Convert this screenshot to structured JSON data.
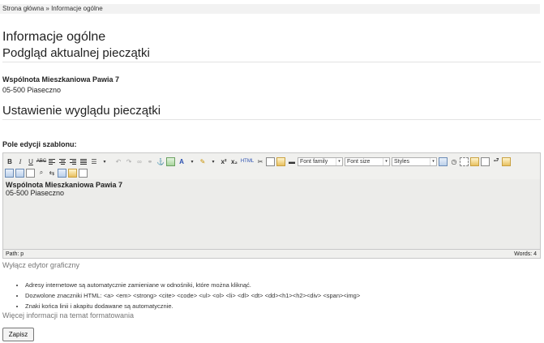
{
  "breadcrumb": {
    "home": "Strona główna",
    "separator": " » ",
    "current": "Informacje ogólne"
  },
  "page_title": "Informacje ogólne",
  "preview": {
    "heading": "Podgląd aktualnej pieczątki",
    "name": "Wspólnota Mieszkaniowa Pawia 7",
    "address": "05-500 Piaseczno"
  },
  "settings": {
    "heading": "Ustawienie wyglądu pieczątki",
    "field_label": "Pole edycji szablonu:"
  },
  "editor": {
    "toolbar": {
      "bold": "B",
      "italic": "I",
      "underline": "U",
      "strike": "ABC",
      "html": "HTML",
      "superscript": "x²",
      "subscript": "x₂",
      "font_color": "A",
      "font_family": "Font family",
      "font_size": "Font size",
      "styles": "Styles",
      "dropdown_arrow": "▾"
    },
    "content_name": "Wspólnota Mieszkaniowa Pawia 7",
    "content_address": "05-500 Piaseczno",
    "path": "Path: p",
    "words": "Words: 4"
  },
  "toggle_editor": "Wyłącz edytor graficzny",
  "hints": [
    "Adresy internetowe są automatycznie zamieniane w odnośniki, które można kliknąć.",
    "Dozwolone znaczniki HTML: <a> <em> <strong> <cite> <code> <ul> <ol> <li> <dl> <dt> <dd><h1><h2><div> <span><img>",
    "Znaki końca linii i akapitu dodawane są automatycznie."
  ],
  "more_info": "Więcej informacji na temat formatowania",
  "save_label": "Zapisz"
}
